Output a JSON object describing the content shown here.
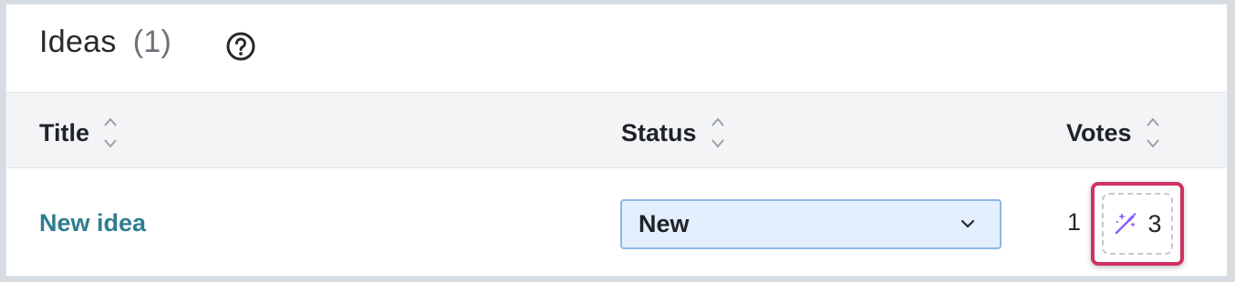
{
  "panel": {
    "title": "Ideas",
    "count": "(1)",
    "help_icon": "question-circle-icon"
  },
  "table": {
    "columns": [
      {
        "label": "Title",
        "sort_icon": "sort-arrows-icon"
      },
      {
        "label": "Status",
        "sort_icon": "sort-arrows-icon"
      },
      {
        "label": "Votes",
        "sort_icon": "sort-arrows-icon"
      }
    ],
    "rows": [
      {
        "title": "New idea",
        "status": "New",
        "votes": "1",
        "ai_votes": "3",
        "ai_icon": "magic-wand-icon"
      }
    ]
  },
  "colors": {
    "link": "#2f7d8f",
    "select_bg": "#e3effc",
    "select_border": "#8db8e4",
    "highlight": "#cf3360",
    "wand": "#8b5cf6"
  }
}
